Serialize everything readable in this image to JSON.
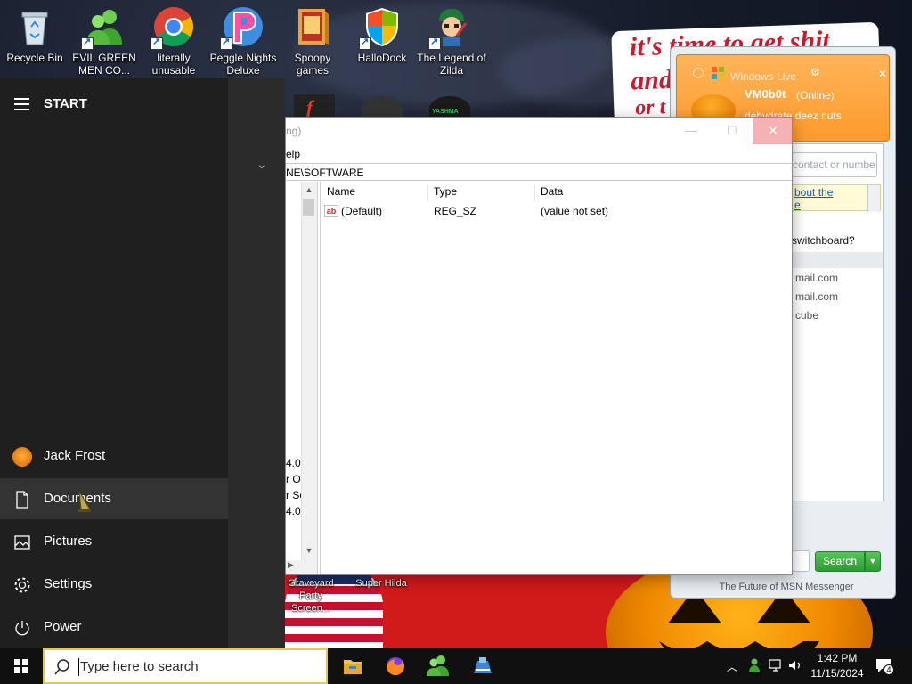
{
  "desktop": {
    "icons": [
      {
        "label": "Recycle Bin"
      },
      {
        "label": "EVIL GREEN MEN CO..."
      },
      {
        "label": "literally unusable"
      },
      {
        "label": "Peggle Nights Deluxe"
      },
      {
        "label": "Spoopy games"
      },
      {
        "label": "HalloDock"
      },
      {
        "label": "The Legend of Zilda"
      }
    ],
    "bg_icons": [
      {
        "label": "Graveyard Party Screen..."
      },
      {
        "label": "Super Hilda"
      }
    ],
    "meme_lines": [
      "it's time to get shit",
      "and",
      "or t"
    ]
  },
  "start_menu": {
    "title": "START",
    "items": [
      {
        "label": "Jack Frost",
        "icon": "user-avatar"
      },
      {
        "label": "Documents",
        "icon": "document-icon"
      },
      {
        "label": "Pictures",
        "icon": "pictures-icon"
      },
      {
        "label": "Settings",
        "icon": "gear-icon"
      },
      {
        "label": "Power",
        "icon": "power-icon"
      }
    ]
  },
  "regedit": {
    "title_fragment": "ng)",
    "menu_fragment": "elp",
    "address": "NE\\SOFTWARE",
    "columns": [
      "Name",
      "Type",
      "Data"
    ],
    "rows": [
      {
        "name": "(Default)",
        "type": "REG_SZ",
        "data": "(value not set)"
      }
    ],
    "tree_fragments": [
      "4.0",
      "r O",
      "r Sc",
      "4.0"
    ]
  },
  "msn": {
    "toast": {
      "title": "Windows Live",
      "name": "VM0b0t",
      "status": "(Online)",
      "message": "dehydrate deez nuts"
    },
    "search_placeholder": "contact or numbe",
    "ad_lines": [
      "bout the",
      "e"
    ],
    "question": "switchboard?",
    "contacts": [
      "mail.com",
      "mail.com",
      "cube"
    ],
    "search_button": "Search",
    "footer": "The Future of MSN Messenger"
  },
  "taskbar": {
    "search_placeholder": "Type here to search",
    "apps": [
      "file-explorer-icon",
      "firefox-icon",
      "msn-icon",
      "dock-icon"
    ],
    "time": "1:42 PM",
    "date": "11/15/2024",
    "notification_count": "4"
  },
  "colors": {
    "accent_orange": "#ff9a2c",
    "start_bg": "#1f1f1f",
    "taskbar_bg": "#101010",
    "msn_green": "#2e9a33"
  }
}
